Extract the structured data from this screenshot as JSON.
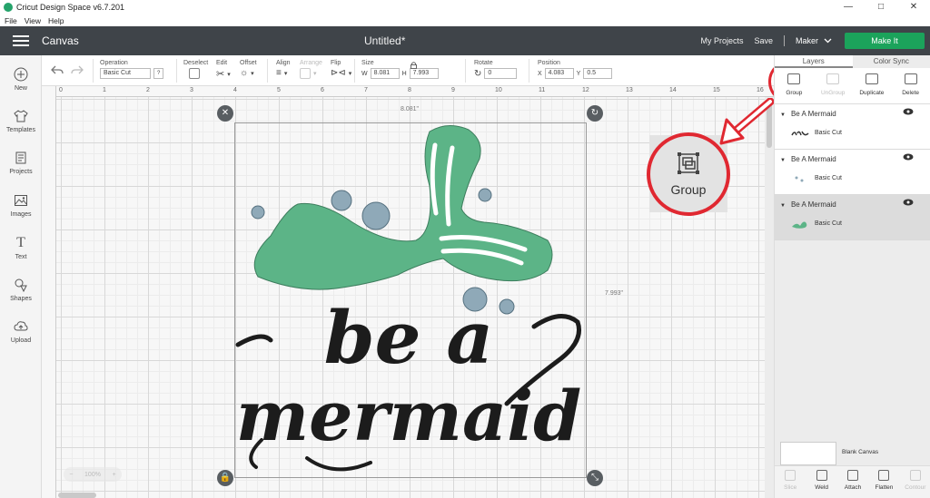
{
  "window": {
    "title": "Cricut Design Space  v6.7.201",
    "minimize": "—",
    "maximize": "□",
    "close": "✕"
  },
  "menu": [
    "File",
    "View",
    "Help"
  ],
  "header": {
    "section": "Canvas",
    "doc_title": "Untitled*",
    "my_projects": "My Projects",
    "save": "Save",
    "machine": "Maker",
    "make_it": "Make It",
    "accent": "#1ba35b"
  },
  "toolbar": {
    "operation_label": "Operation",
    "operation_value": "Basic Cut",
    "deselect_label": "Deselect",
    "edit_label": "Edit",
    "offset_label": "Offset",
    "align_label": "Align",
    "arrange_label": "Arrange",
    "flip_label": "Flip",
    "size_label": "Size",
    "w_label": "W",
    "w_value": "8.081",
    "h_label": "H",
    "h_value": "7.993",
    "rotate_label": "Rotate",
    "rotate_value": "0",
    "position_label": "Position",
    "x_label": "X",
    "x_value": "4.083",
    "y_label": "Y",
    "y_value": "0.5"
  },
  "sidebar": [
    {
      "label": "New",
      "icon": "plus-circle-icon"
    },
    {
      "label": "Templates",
      "icon": "shirt-icon"
    },
    {
      "label": "Projects",
      "icon": "projects-icon"
    },
    {
      "label": "Images",
      "icon": "image-icon"
    },
    {
      "label": "Text",
      "icon": "text-icon"
    },
    {
      "label": "Shapes",
      "icon": "shapes-icon"
    },
    {
      "label": "Upload",
      "icon": "upload-cloud-icon"
    }
  ],
  "ruler": {
    "top": [
      "0",
      "1",
      "2",
      "3",
      "4",
      "5",
      "6",
      "7",
      "8",
      "9",
      "10",
      "11",
      "12",
      "13",
      "14",
      "15",
      "16"
    ]
  },
  "canvas": {
    "width_label": "8.081\"",
    "height_label": "7.993\"",
    "zoom": "100%",
    "design_text_line1": "be a",
    "design_text_line2": "mermaid",
    "tail_color": "#5cb487",
    "bubble_color": "#8fa9b8",
    "text_color": "#1c1c1c"
  },
  "callout": {
    "label": "Group",
    "ring_color": "#e02831"
  },
  "right_panel": {
    "tabs": [
      "Layers",
      "Color Sync"
    ],
    "actions": [
      {
        "label": "Group",
        "disabled": false
      },
      {
        "label": "UnGroup",
        "disabled": true
      },
      {
        "label": "Duplicate",
        "disabled": false
      },
      {
        "label": "Delete",
        "disabled": false
      }
    ],
    "layers": [
      {
        "name": "Be A Mermaid",
        "type": "Basic Cut"
      },
      {
        "name": "Be A Mermaid",
        "type": "Basic Cut"
      },
      {
        "name": "Be A Mermaid",
        "type": "Basic Cut"
      }
    ],
    "blank_canvas": "Blank Canvas",
    "bottom": [
      {
        "label": "Slice",
        "disabled": true
      },
      {
        "label": "Weld",
        "disabled": false
      },
      {
        "label": "Attach",
        "disabled": false
      },
      {
        "label": "Flatten",
        "disabled": false
      },
      {
        "label": "Contour",
        "disabled": true
      }
    ]
  }
}
